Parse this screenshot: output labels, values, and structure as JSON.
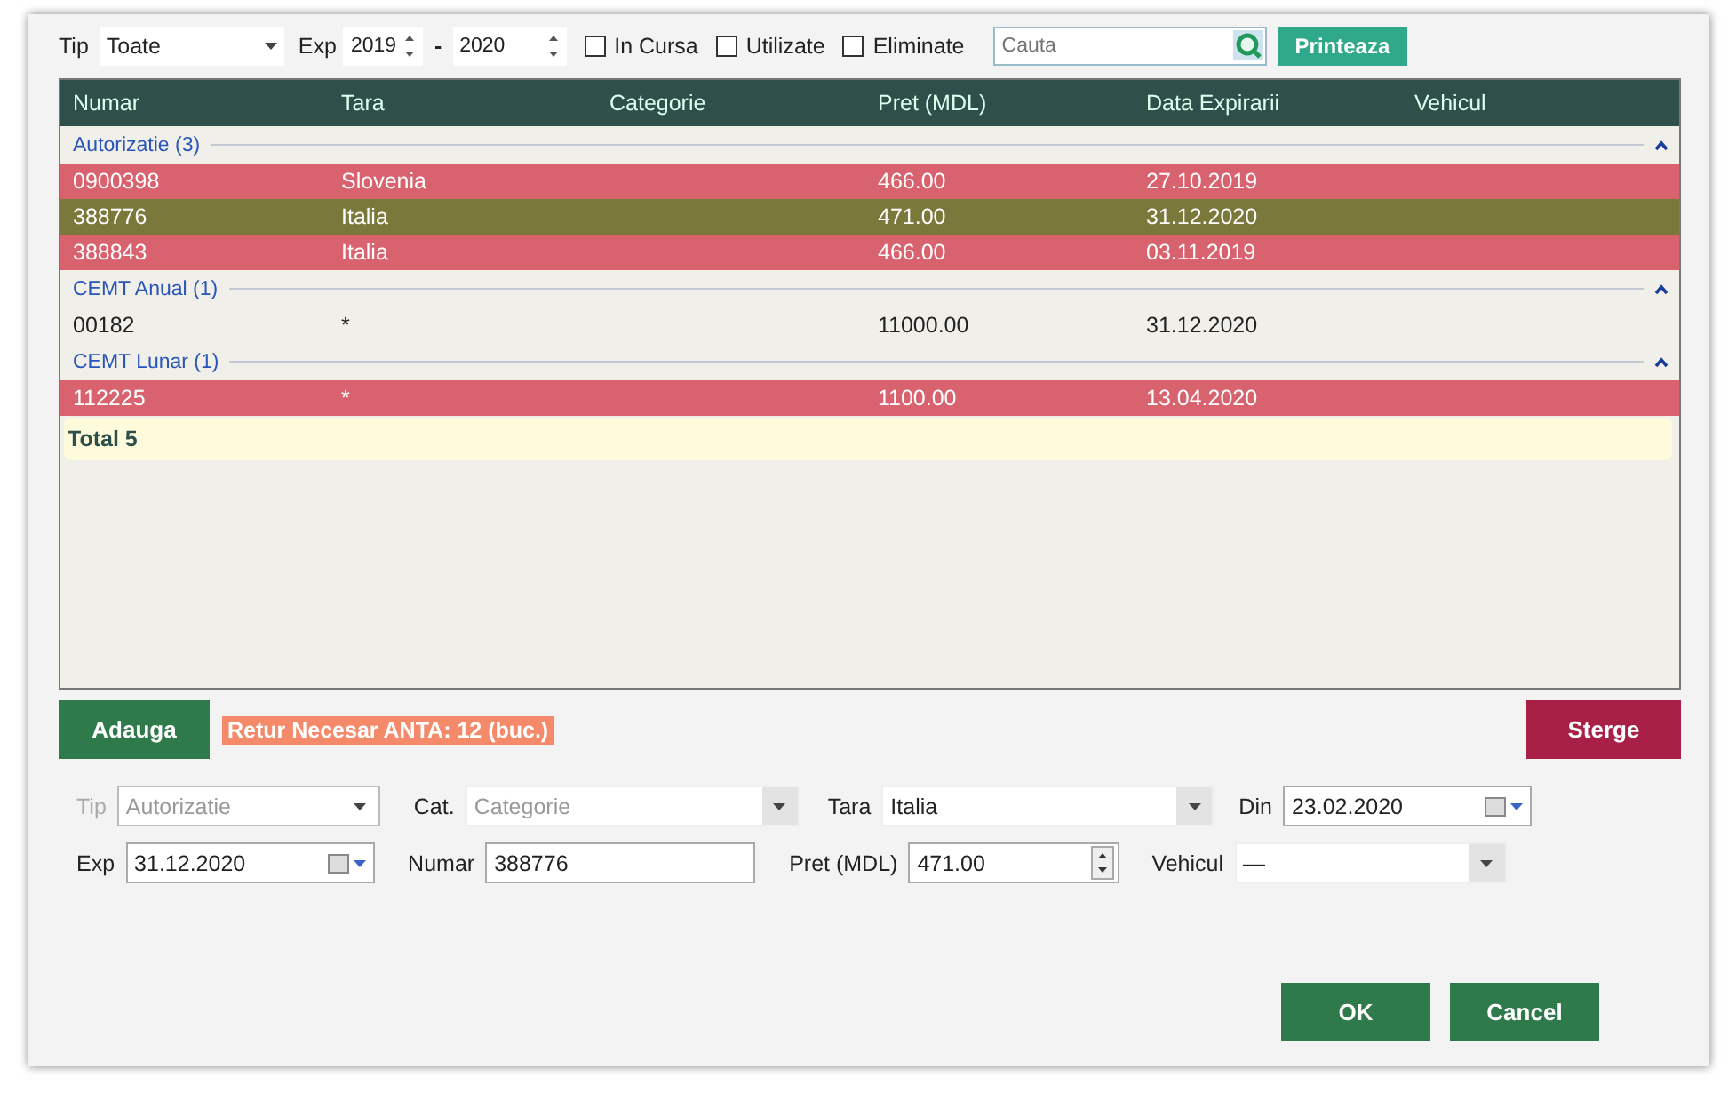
{
  "filters": {
    "tip_label": "Tip",
    "tip_value": "Toate",
    "exp_label": "Exp",
    "exp_from": "2019",
    "range_separator": "-",
    "exp_to": "2020",
    "checkboxes": [
      {
        "label": "In Cursa",
        "checked": false
      },
      {
        "label": "Utilizate",
        "checked": false
      },
      {
        "label": "Eliminate",
        "checked": false
      }
    ],
    "search": {
      "placeholder": "Cauta"
    },
    "print_button": "Printeaza"
  },
  "table": {
    "columns": [
      "Numar",
      "Tara",
      "Categorie",
      "Pret (MDL)",
      "Data Expirarii",
      "Vehicul"
    ],
    "groups": [
      {
        "title": "Autorizatie (3)",
        "expanded": true,
        "rows": [
          {
            "cells": [
              "0900398",
              "Slovenia",
              "",
              "466.00",
              "27.10.2019",
              ""
            ],
            "color": "#d9626f"
          },
          {
            "cells": [
              "388776",
              "Italia",
              "",
              "471.00",
              "31.12.2020",
              ""
            ],
            "color": "#7b783b"
          },
          {
            "cells": [
              "388843",
              "Italia",
              "",
              "466.00",
              "03.11.2019",
              ""
            ],
            "color": "#d9626f"
          }
        ]
      },
      {
        "title": "CEMT Anual (1)",
        "expanded": true,
        "rows": [
          {
            "cells": [
              "00182",
              "*",
              "",
              "11000.00",
              "31.12.2020",
              ""
            ]
          }
        ]
      },
      {
        "title": "CEMT Lunar (1)",
        "expanded": true,
        "rows": [
          {
            "cells": [
              "112225",
              "*",
              "",
              "1100.00",
              "13.04.2020",
              ""
            ],
            "color": "#d9626f"
          }
        ]
      }
    ],
    "total": "Total 5"
  },
  "add_button": "Adauga",
  "notice": "Retur Necesar ANTA: 12 (buc.)",
  "delete_button": "Sterge",
  "form": [
    [
      {
        "label": "Tip",
        "kind": "select",
        "value": "Autorizatie",
        "disabled": true
      },
      {
        "label": "Cat.",
        "kind": "select",
        "placeholder": "Categorie",
        "disabled": false
      },
      {
        "label": "Tara",
        "kind": "select",
        "value": "Italia",
        "disabled": false
      },
      {
        "label": "Din",
        "kind": "date",
        "value": "23.02.2020",
        "disabled": false
      }
    ],
    [
      {
        "label": "Exp",
        "kind": "date",
        "value": "31.12.2020",
        "disabled": false
      },
      {
        "label": "Numar",
        "kind": "text",
        "value": "388776",
        "disabled": false
      },
      {
        "label": "Pret (MDL)",
        "kind": "spin",
        "value": "471.00",
        "disabled": false
      },
      {
        "label": "Vehicul",
        "kind": "select",
        "value": "—",
        "disabled": false
      }
    ]
  ],
  "ok_button": "OK",
  "cancel_button": "Cancel"
}
